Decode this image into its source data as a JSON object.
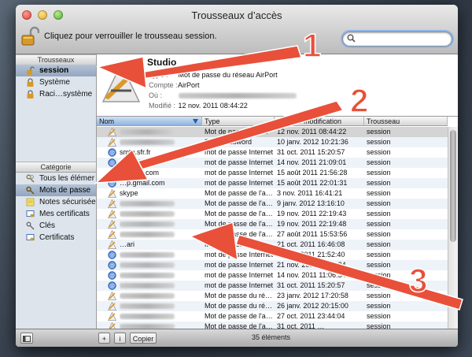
{
  "window": {
    "title": "Trousseaux d’accès"
  },
  "toolbar": {
    "lock_label": "Cliquez pour verrouiller le trousseau session.",
    "search_placeholder": ""
  },
  "sidebar": {
    "keychains_header": "Trousseaux",
    "keychains": [
      {
        "label": "session",
        "icon": "open-lock-icon"
      },
      {
        "label": "Système",
        "icon": "lock-icon"
      },
      {
        "label": "Raci…système",
        "icon": "lock-icon"
      }
    ],
    "category_header": "Catégorie",
    "categories": [
      {
        "label": "Tous les élémer",
        "icon": "keys-icon"
      },
      {
        "label": "Mots de passe",
        "icon": "key-chain-icon"
      },
      {
        "label": "Notes sécurisée",
        "icon": "note-icon"
      },
      {
        "label": "Mes certificats",
        "icon": "certificate-icon"
      },
      {
        "label": "Clés",
        "icon": "key-icon"
      },
      {
        "label": "Certificats",
        "icon": "certificate-icon"
      }
    ]
  },
  "detail": {
    "name": "Studio",
    "type_label": "Type :",
    "type_value": "Mot de passe du réseau AirPort",
    "account_label": "Compte :",
    "account_value": "AirPort",
    "where_label": "Où :",
    "modified_label": "Modifié :",
    "modified_value": "12 nov. 2011 08:44:22"
  },
  "table": {
    "columns": [
      "Nom",
      "Type",
      "Date de modification",
      "Trousseau"
    ],
    "rows": [
      {
        "icon": "app-icon",
        "name": "",
        "type": "Mot de passe du r…",
        "date": "12 nov. 2011 08:44:22",
        "keychain": "session"
      },
      {
        "icon": "app-icon",
        "name": "",
        "type": "80… password",
        "date": "10 janv. 2012 10:21:36",
        "keychain": "session"
      },
      {
        "icon": "globe-icon",
        "name": "smtp.sfr.fr",
        "type": "mot de passe Internet",
        "date": "31 oct. 2011 15:20:57",
        "keychain": "session"
      },
      {
        "icon": "globe-icon",
        "name": "smtp.live…",
        "type": "mot de passe Internet",
        "date": "14 nov. 2011 21:09:01",
        "keychain": "session"
      },
      {
        "icon": "globe-icon",
        "name": "…gmail.com",
        "type": "mot de passe Internet",
        "date": "15 août 2011 21:56:28",
        "keychain": "session"
      },
      {
        "icon": "globe-icon",
        "name": "…p.gmail.com",
        "type": "mot de passe Internet",
        "date": "15 août 2011 22:01:31",
        "keychain": "session"
      },
      {
        "icon": "app-icon",
        "name": "skype",
        "type": "Mot de passe de l'a…",
        "date": "3 nov. 2011 16:41:21",
        "keychain": "session"
      },
      {
        "icon": "app-icon",
        "name": "",
        "type": "Mot de passe de l'a…",
        "date": "9 janv. 2012 13:16:10",
        "keychain": "session"
      },
      {
        "icon": "app-icon",
        "name": "",
        "type": "Mot de passe de l'a…",
        "date": "19 nov. 2011 22:19:43",
        "keychain": "session"
      },
      {
        "icon": "app-icon",
        "name": "",
        "type": "Mot de passe de l'a…",
        "date": "19 nov. 2011 22:19:48",
        "keychain": "session"
      },
      {
        "icon": "app-icon",
        "name": "",
        "type": "Mot de passe de l'a…",
        "date": "27 août 2011 15:53:56",
        "keychain": "session"
      },
      {
        "icon": "app-icon",
        "name": "…ari",
        "type": "Mot de passe de l'a…",
        "date": "21 oct. 2011 16:46:08",
        "keychain": "session"
      },
      {
        "icon": "globe-icon",
        "name": "",
        "type": "mot de passe Internet",
        "date": "31 oct. 2011 21:52:40",
        "keychain": "session"
      },
      {
        "icon": "globe-icon",
        "name": "",
        "type": "mot de passe Internet",
        "date": "21 nov. 2011 11:35:24",
        "keychain": "session"
      },
      {
        "icon": "globe-icon",
        "name": "",
        "type": "mot de passe Internet",
        "date": "14 nov. 2011 11:06:34",
        "keychain": "session"
      },
      {
        "icon": "globe-icon",
        "name": "",
        "type": "mot de passe Internet",
        "date": "31 oct. 2011 15:20:57",
        "keychain": "session"
      },
      {
        "icon": "app-icon",
        "name": "",
        "type": "Mot de passe du ré…",
        "date": "23 janv. 2012 17:20:58",
        "keychain": "session"
      },
      {
        "icon": "app-icon",
        "name": "",
        "type": "Mot de passe du ré…",
        "date": "26 janv. 2012 20:15:00",
        "keychain": "session"
      },
      {
        "icon": "app-icon",
        "name": "",
        "type": "Mot de passe de l'a…",
        "date": "27 oct. 2011 23:44:04",
        "keychain": "session"
      },
      {
        "icon": "app-icon",
        "name": "",
        "type": "Mot de passe de l'a…",
        "date": "31 oct. 2011 …",
        "keychain": "session"
      }
    ]
  },
  "bottombar": {
    "add_label": "+",
    "info_label": "i",
    "copy_label": "Copier",
    "status": "35 éléments"
  },
  "annotations": [
    {
      "label": "1",
      "color": "#e8503a"
    },
    {
      "label": "2",
      "color": "#e8503a"
    },
    {
      "label": "3",
      "color": "#e8503a"
    }
  ]
}
